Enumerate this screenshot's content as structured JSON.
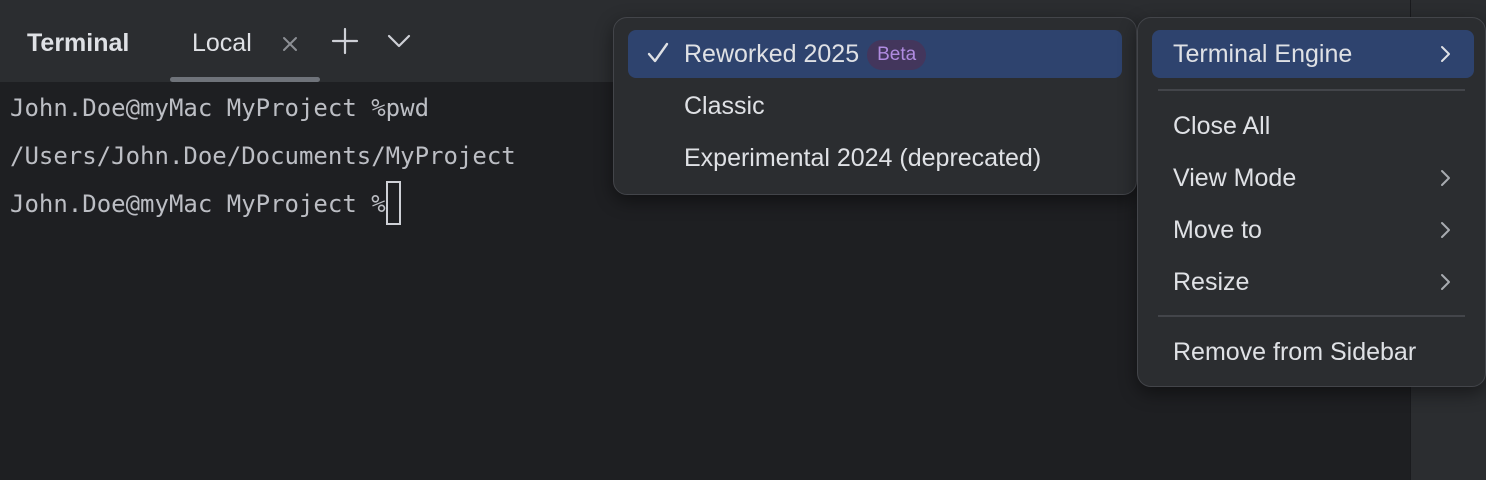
{
  "toolwindow": {
    "title": "Terminal",
    "tabs": [
      {
        "label": "Local",
        "active": true
      }
    ],
    "new_tab_icon": "plus-icon",
    "more_tabs_icon": "chevron-down-icon"
  },
  "terminal": {
    "lines": [
      "John.Doe@myMac MyProject %pwd",
      "/Users/John.Doe/Documents/MyProject",
      "John.Doe@myMac MyProject %"
    ]
  },
  "engine_menu": {
    "items": [
      {
        "label": "Reworked 2025",
        "badge": "Beta",
        "checked": true
      },
      {
        "label": "Classic",
        "checked": false
      },
      {
        "label": "Experimental 2024 (deprecated)",
        "checked": false
      }
    ]
  },
  "options_menu": {
    "items": [
      {
        "label": "Terminal Engine",
        "submenu": true,
        "selected": true
      },
      {
        "label": "Close All",
        "submenu": false
      },
      {
        "label": "View Mode",
        "submenu": true
      },
      {
        "label": "Move to",
        "submenu": true
      },
      {
        "label": "Resize",
        "submenu": true
      },
      {
        "label": "Remove from Sidebar",
        "submenu": false
      }
    ]
  },
  "colors": {
    "background": "#1e1f22",
    "panel": "#2b2d30",
    "selection": "#2e436e",
    "badge_bg": "#43365c",
    "badge_text": "#b08be0"
  }
}
